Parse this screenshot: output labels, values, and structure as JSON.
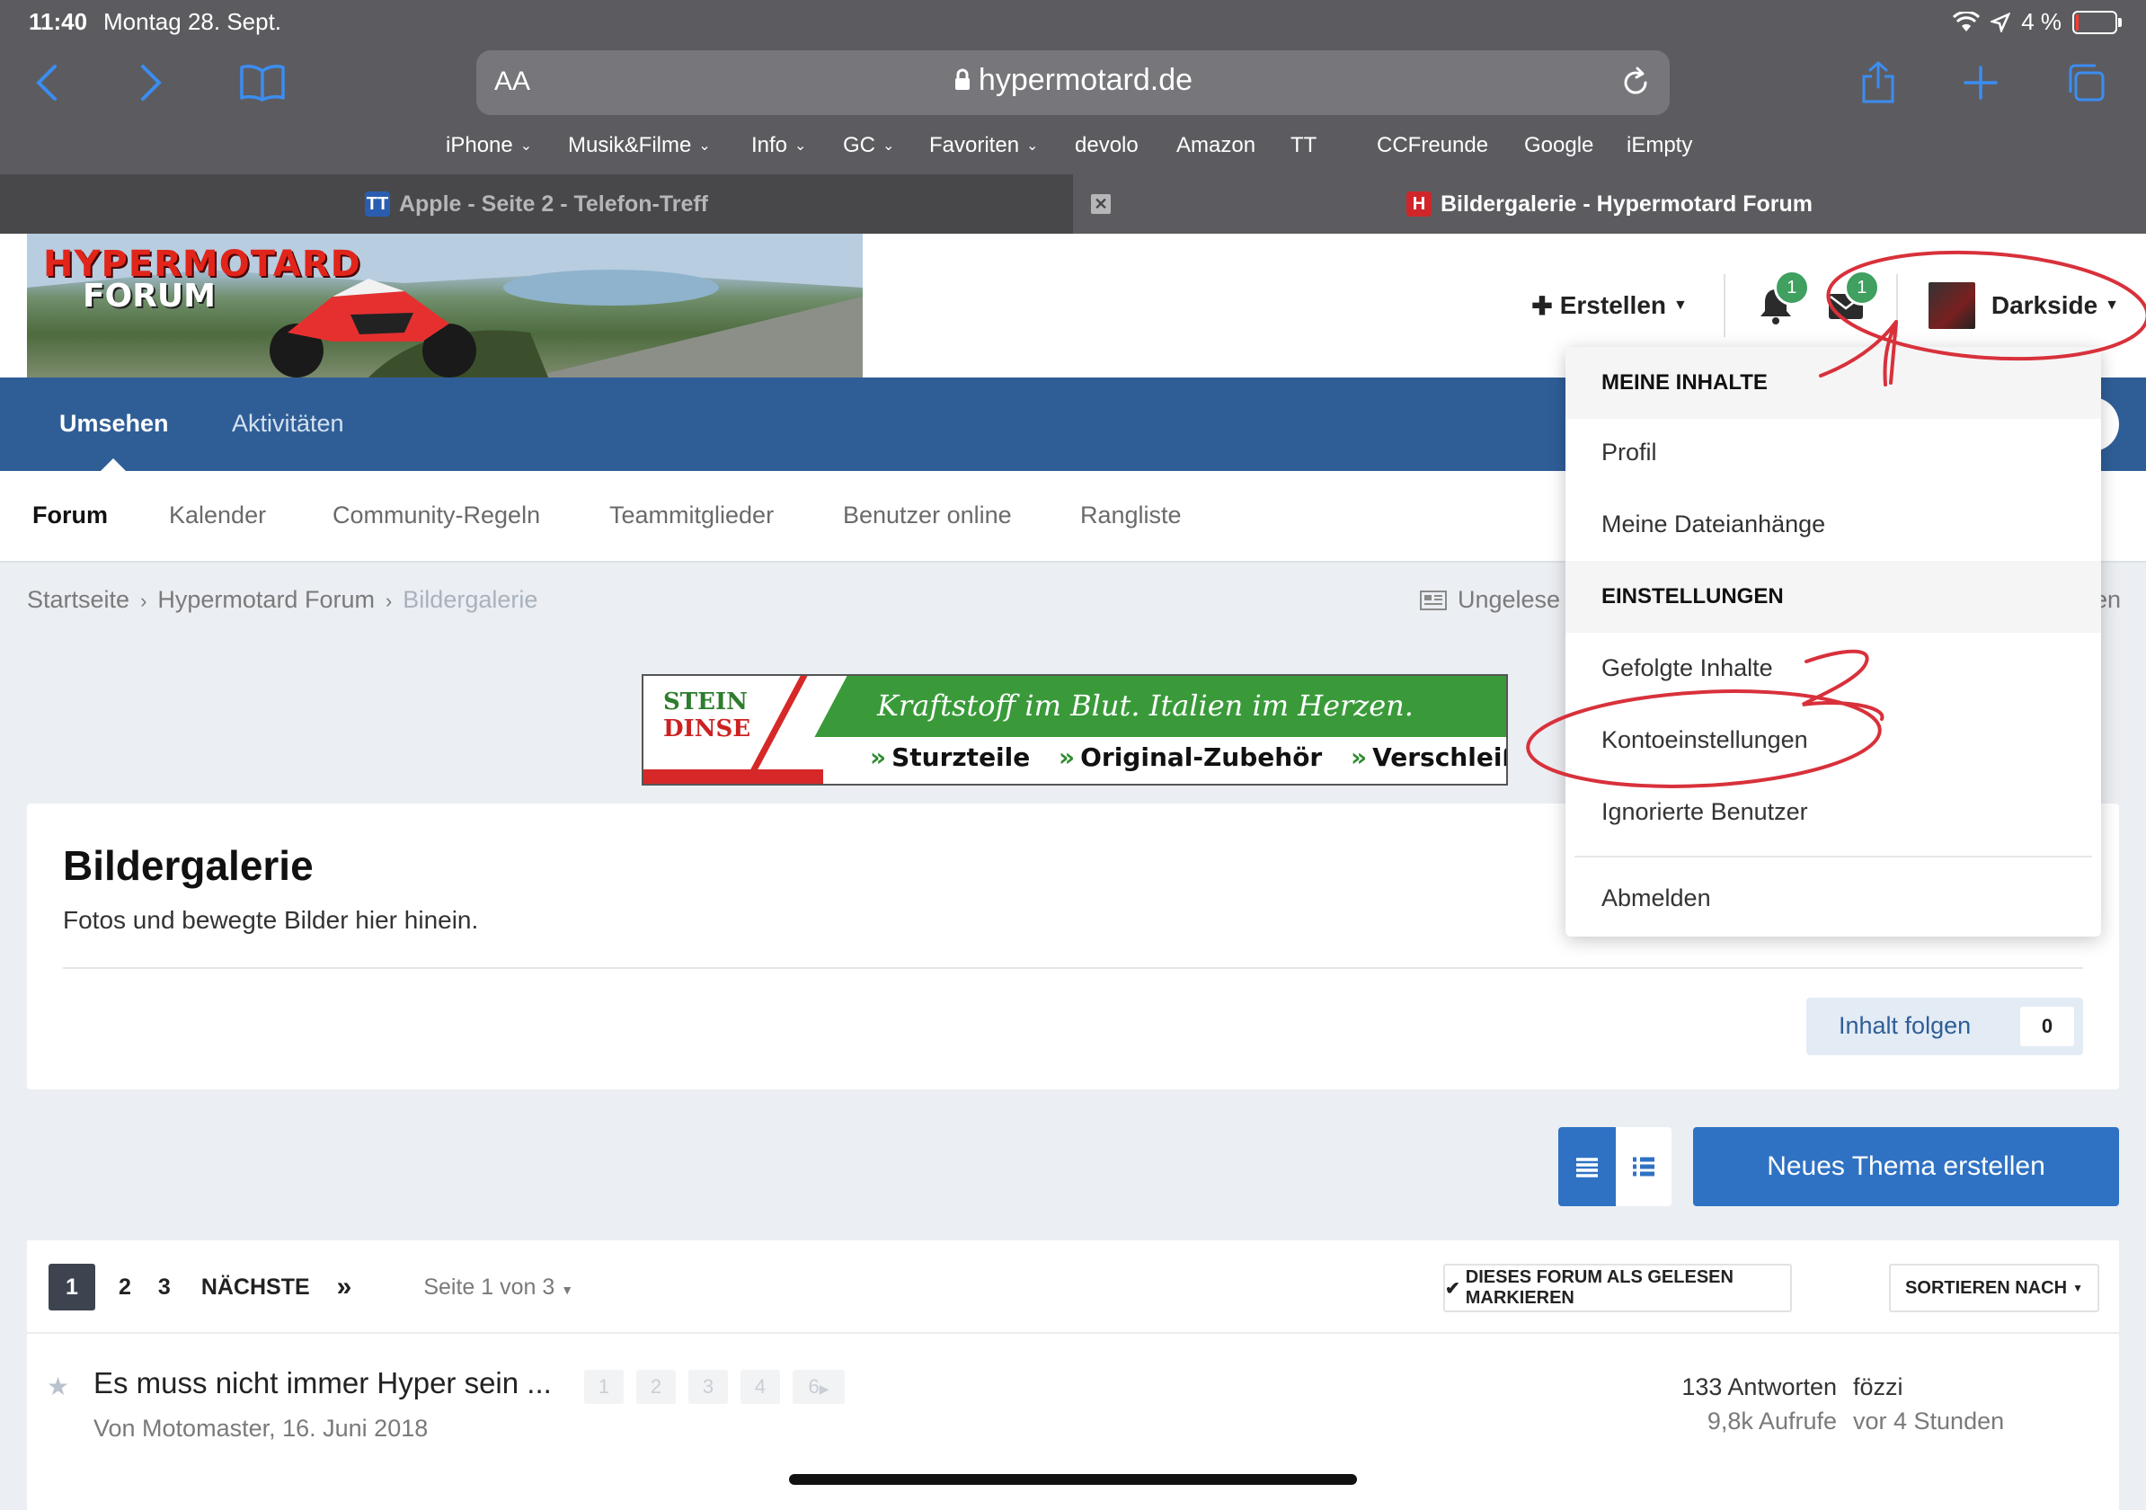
{
  "status": {
    "time": "11:40",
    "date": "Montag 28. Sept.",
    "battery": "4 %"
  },
  "browser": {
    "url": "hypermotard.de",
    "aa": "AA",
    "bookmarks": [
      {
        "label": "iPhone",
        "dropdown": true
      },
      {
        "label": "Musik&Filme",
        "dropdown": true
      },
      {
        "label": "Info",
        "dropdown": true
      },
      {
        "label": "GC",
        "dropdown": true
      },
      {
        "label": "Favoriten",
        "dropdown": true
      },
      {
        "label": "devolo",
        "dropdown": false
      },
      {
        "label": "Amazon",
        "dropdown": false
      },
      {
        "label": "TT",
        "dropdown": false
      },
      {
        "label": "CCFreunde",
        "dropdown": false
      },
      {
        "label": "Google",
        "dropdown": false
      },
      {
        "label": "iEmpty",
        "dropdown": false
      }
    ],
    "tabs": [
      {
        "title": "Apple - Seite 2 - Telefon-Treff",
        "favicon": "TT",
        "active": false
      },
      {
        "title": "Bildergalerie - Hypermotard Forum",
        "favicon": "H",
        "active": true
      }
    ]
  },
  "header": {
    "logo_line1": "HYPERMOTARD",
    "logo_line2": "FORUM",
    "create_label": "Erstellen",
    "notifications_count": "1",
    "messages_count": "1",
    "user_name": "Darkside"
  },
  "primary_nav": {
    "items": [
      "Umsehen",
      "Aktivitäten"
    ]
  },
  "secondary_nav": {
    "items": [
      "Forum",
      "Kalender",
      "Community-Regeln",
      "Teammitglieder",
      "Benutzer online",
      "Rangliste"
    ]
  },
  "breadcrumb": {
    "items": [
      "Startseite",
      "Hypermotard Forum",
      "Bildergalerie"
    ],
    "unread": "Ungelese",
    "unread_right": "en"
  },
  "ad": {
    "brand_line1": "STEIN",
    "brand_line2": "DINSE",
    "slogan": "Kraftstoff im Blut. Italien im Herzen.",
    "links": [
      "Sturzteile",
      "Original-Zubehör",
      "Verschleißteile"
    ]
  },
  "forum": {
    "title": "Bildergalerie",
    "description": "Fotos und bewegte Bilder hier hinein.",
    "follow_label": "Inhalt folgen",
    "follow_count": "0",
    "new_topic_label": "Neues Thema erstellen"
  },
  "pagination": {
    "pages": [
      "1",
      "2",
      "3"
    ],
    "next_label": "NÄCHSTE",
    "last_label": "»",
    "page_info": "Seite 1 von 3",
    "mark_read_label": "DIESES FORUM ALS GELESEN MARKIEREN",
    "sort_label": "SORTIEREN NACH"
  },
  "topics": [
    {
      "title": "Es muss nicht immer Hyper sein ...",
      "pages": [
        "1",
        "2",
        "3",
        "4",
        "6"
      ],
      "meta": "Von Motomaster, 16. Juni 2018",
      "replies": "133 Antworten",
      "views": "9,8k Aufrufe",
      "last_poster": "fözzi",
      "last_time": "vor 4 Stunden"
    }
  ],
  "dropdown": {
    "section1": "MEINE INHALTE",
    "items1": [
      "Profil",
      "Meine Dateianhänge"
    ],
    "section2": "EINSTELLUNGEN",
    "items2": [
      "Gefolgte Inhalte",
      "Kontoeinstellungen",
      "Ignorierte Benutzer"
    ],
    "logout": "Abmelden"
  },
  "colors": {
    "brand_blue": "#2f5e97",
    "button_blue": "#2f72c4",
    "badge_green": "#3fa05f",
    "annotation_red": "#d8313b",
    "safari_gray": "#5c5c60"
  }
}
